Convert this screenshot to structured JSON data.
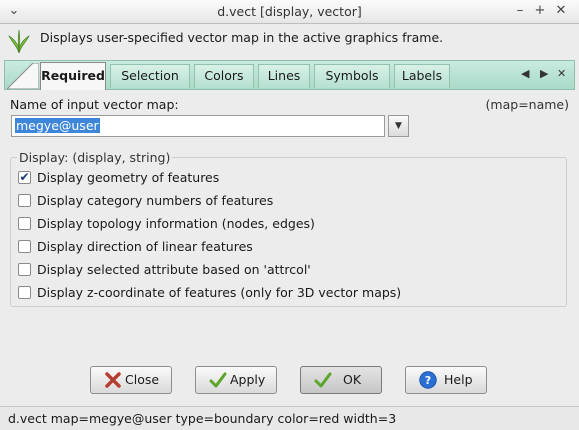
{
  "window": {
    "title": "d.vect [display, vector]",
    "controls": [
      "chevron-down-icon",
      "minimize-icon",
      "maximize-icon",
      "close-icon"
    ]
  },
  "header": {
    "description": "Displays user-specified vector map in the active graphics frame."
  },
  "tabs": [
    {
      "label": "Required",
      "active": true
    },
    {
      "label": "Selection",
      "active": false
    },
    {
      "label": "Colors",
      "active": false
    },
    {
      "label": "Lines",
      "active": false
    },
    {
      "label": "Symbols",
      "active": false
    },
    {
      "label": "Labels",
      "active": false
    }
  ],
  "tab_nav": {
    "prev": "◀",
    "next": "▶",
    "close": "✕"
  },
  "map_field": {
    "label": "Name of input vector map:",
    "key": "(map=name)",
    "value": "megye@user"
  },
  "display_group": {
    "label": "Display: (display, string)",
    "options": [
      {
        "label": "Display geometry of features",
        "checked": true
      },
      {
        "label": "Display category numbers of features",
        "checked": false
      },
      {
        "label": "Display topology information (nodes, edges)",
        "checked": false
      },
      {
        "label": "Display direction of linear features",
        "checked": false
      },
      {
        "label": "Display selected attribute based on 'attrcol'",
        "checked": false
      },
      {
        "label": "Display z-coordinate of features (only for 3D vector maps)",
        "checked": false
      }
    ]
  },
  "buttons": {
    "close": "Close",
    "apply": "Apply",
    "ok": "OK",
    "help": "Help"
  },
  "status": {
    "command": "d.vect map=megye@user type=boundary color=red width=3"
  },
  "colors": {
    "tab_accent": "#b5e0d0",
    "selection": "#3d86d9",
    "help_blue": "#2b6fd3",
    "close_red": "#c43b2e",
    "check_green": "#5aa52a"
  }
}
